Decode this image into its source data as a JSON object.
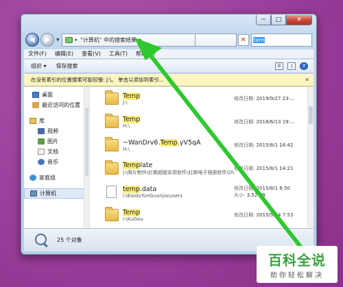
{
  "window": {
    "controls": {
      "minimize": "─",
      "maximize": "□",
      "close": "✕"
    }
  },
  "address": {
    "crumb_prefix": "▸",
    "crumb_text": "\"计算机\" 中的搜索结果",
    "crumb_suffix": "▸",
    "stop_label": "✕",
    "search_selected": "tem"
  },
  "menu": [
    "文件(F)",
    "编辑(E)",
    "查看(V)",
    "工具(T)",
    "帮助(H)"
  ],
  "toolbar": {
    "organize": "组织 ▾",
    "save_search": "保存搜索"
  },
  "infobar": {
    "text": "在没有索引的位置搜索可能较慢: J:\\。 单击以添加到索引...",
    "close": "✕"
  },
  "nav": {
    "desktop": "桌面",
    "recent": "最近访问的位置",
    "library": "库",
    "video": "视频",
    "pictures": "图片",
    "documents": "文档",
    "music": "音乐",
    "homegroup": "家庭组",
    "computer": "计算机"
  },
  "files": [
    {
      "name_pre": "",
      "name_hl": "Temp",
      "name_post": "",
      "path": "J:\\",
      "meta_label": "修改日期:",
      "meta_value": "2019/9/27 23:...",
      "meta2_label": "",
      "meta2_value": "",
      "type": "folder"
    },
    {
      "name_pre": "",
      "name_hl": "Temp",
      "name_post": "",
      "path": "H:\\",
      "meta_label": "修改日期:",
      "meta_value": "2018/6/13 19:...",
      "meta2_label": "",
      "meta2_value": "",
      "type": "folder"
    },
    {
      "name_pre": "~WanDrv6.",
      "name_hl": "Temp",
      "name_post": ".yV5qA",
      "path": "H:\\",
      "meta_label": "修改日期:",
      "meta_value": "2015/8/1 16:42",
      "meta2_label": "",
      "meta2_value": "",
      "type": "folder"
    },
    {
      "name_pre": "",
      "name_hl": "Temp",
      "name_post": "late",
      "path": "J:\\照片制作\\红枫超级实用软件\\红枫电子相册软件\\DVD相册电影故事...",
      "meta_label": "修改日期:",
      "meta_value": "2015/8/1 14:21",
      "meta2_label": "",
      "meta2_value": "",
      "type": "folder"
    },
    {
      "name_pre": "",
      "name_hl": "temp",
      "name_post": ".data",
      "path": "I:\\BaiduYunGuanjia\\users",
      "meta_label": "修改日期:",
      "meta_value": "2015/8/1 8:50",
      "meta2_label": "大小:",
      "meta2_value": "3.52 KB",
      "type": "doc"
    },
    {
      "name_pre": "",
      "name_hl": "Temp",
      "name_post": "",
      "path": "I:\\KuGou",
      "meta_label": "修改日期:",
      "meta_value": "2015/5/14 7:53",
      "meta2_label": "",
      "meta2_value": "",
      "type": "folder"
    }
  ],
  "status": {
    "count": "25 个对象"
  },
  "watermark": {
    "title": "百科全说",
    "subtitle": "助你轻松解决"
  },
  "colors": {
    "desktop": "#9b3f9b",
    "arrow": "#2fc82f",
    "highlight": "#ffef7a"
  }
}
